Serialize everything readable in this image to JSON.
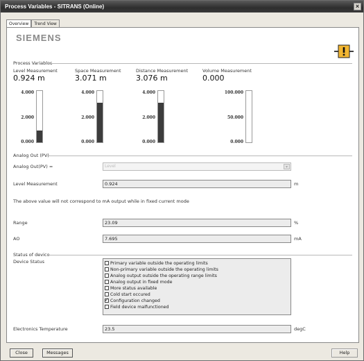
{
  "window": {
    "title": "Process Variables - SITRANS  (Online)"
  },
  "tabs": [
    {
      "label": "Overview"
    },
    {
      "label": "Trend View"
    }
  ],
  "brand": {
    "logo": "SIEMENS"
  },
  "process_variables": {
    "heading": "Process Variables",
    "measurements": [
      {
        "title": "Level Measurement",
        "value": "0.924 m",
        "ticks": [
          "4.000",
          "2.000",
          "0.000"
        ],
        "fill_fraction": 0.23
      },
      {
        "title": "Space Measurement",
        "value": "3.071 m",
        "ticks": [
          "4.000",
          "2.000",
          "0.000"
        ],
        "fill_fraction": 0.77
      },
      {
        "title": "Distance Measurement",
        "value": "3.076 m",
        "ticks": [
          "4.000",
          "2.000",
          "0.000"
        ],
        "fill_fraction": 0.77
      },
      {
        "title": "Volume Measurement",
        "value": "0.000",
        "ticks": [
          "100.000",
          "50.000",
          "0.000"
        ],
        "fill_fraction": 0.0
      }
    ]
  },
  "analog_out": {
    "heading": "Analog Out (PV)",
    "pv_label": "Analog Out(PV) =",
    "pv_value": "Level",
    "level_label": "Level Measurement",
    "level_value": "0.924",
    "level_unit": "m",
    "note": "The above value will not correspond to mA output while in fixed current mode",
    "range_label": "Range",
    "range_value": "23.09",
    "range_unit": "%",
    "ao_label": "AO",
    "ao_value": "7.695",
    "ao_unit": "mA"
  },
  "status": {
    "heading": "Status of device",
    "device_status_label": "Device Status",
    "items": [
      {
        "label": "Primary variable outside the operating limits",
        "checked": false
      },
      {
        "label": "Non-primary variable outside the operating limits",
        "checked": false
      },
      {
        "label": "Analog output outside the operating range limits",
        "checked": false
      },
      {
        "label": "Analog output in fixed mode",
        "checked": false
      },
      {
        "label": "More status available",
        "checked": false
      },
      {
        "label": "Cold start occured",
        "checked": false
      },
      {
        "label": "Configuration changed",
        "checked": true
      },
      {
        "label": "Field device malfunctioned",
        "checked": false
      }
    ],
    "temp_label": "Electronics Temperature",
    "temp_value": "23.5",
    "temp_unit": "degC"
  },
  "footer": {
    "close_label": "Close",
    "messages_label": "Messages",
    "help_label": "Help"
  }
}
